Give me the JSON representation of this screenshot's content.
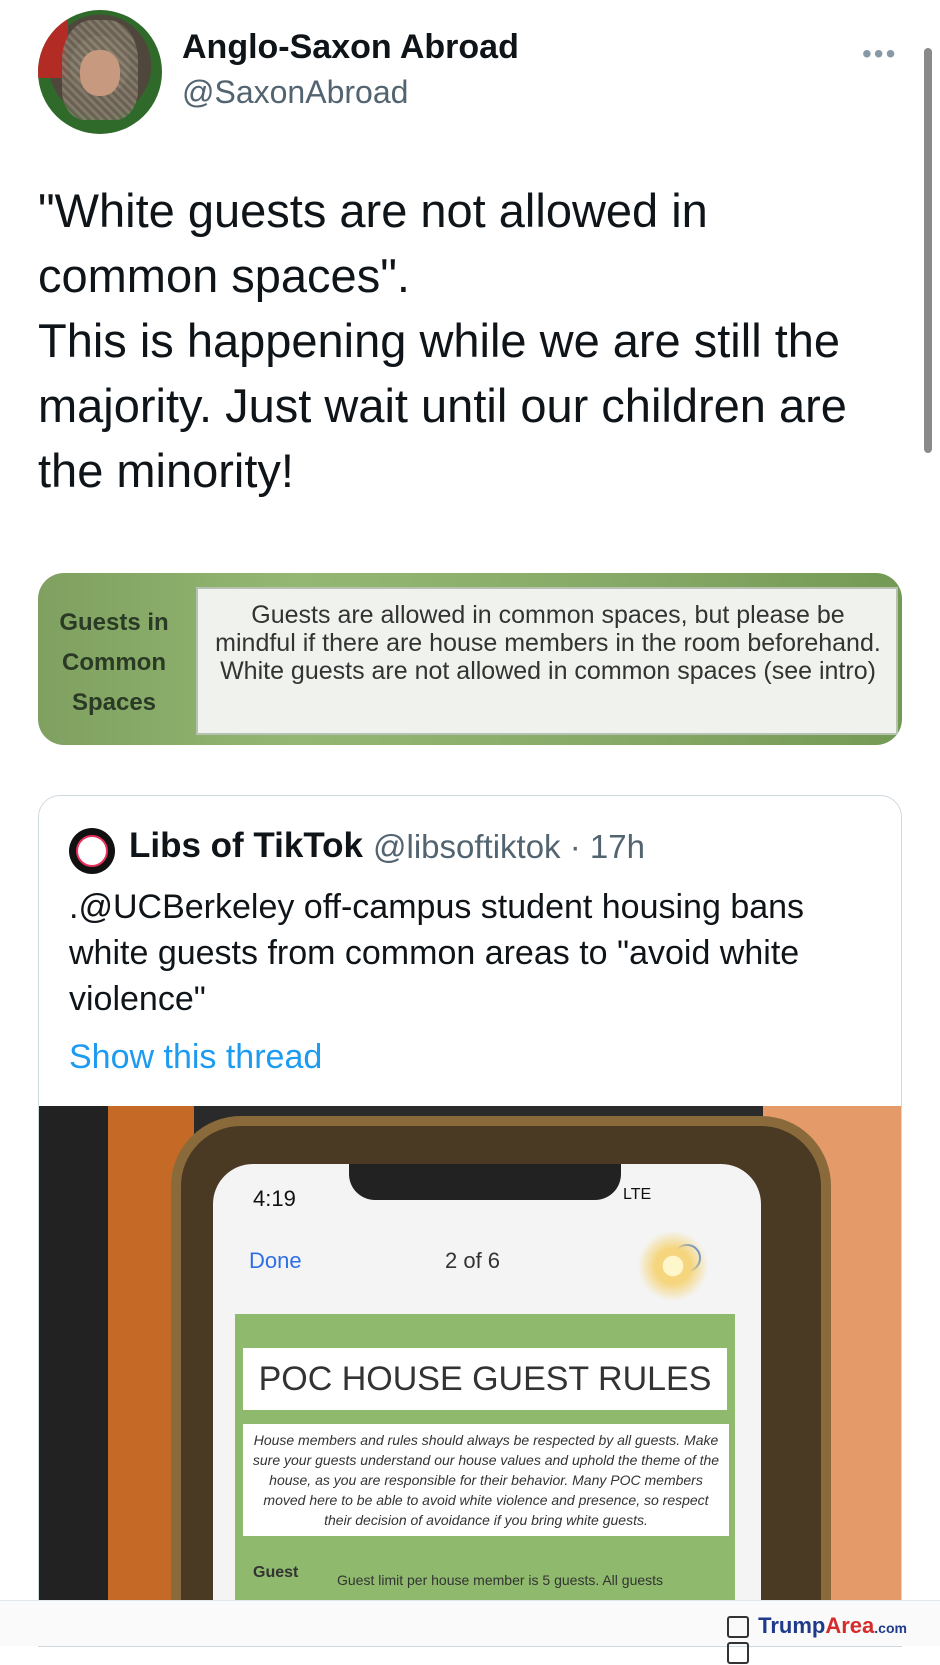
{
  "tweet": {
    "display_name": "Anglo-Saxon Abroad",
    "handle": "@SaxonAbroad",
    "more_icon": "more-dots-icon",
    "text": "\"White guests are not allowed in common spaces\".\nThis is happening while we are still the majority. Just wait until our children are the minority!"
  },
  "image1": {
    "label": "Guests in\nCommon\nSpaces",
    "rule_text": "Guests are allowed in common spaces, but please be mindful if there are house members in the room beforehand. White guests are not allowed in common spaces (see intro)"
  },
  "quoted": {
    "display_name": "Libs of TikTok",
    "handle_time": "@libsoftiktok · 17h",
    "avatar_label": "Libs of TikTok",
    "text": ".@UCBerkeley off-campus student housing bans white guests from common areas to \"avoid white violence\"",
    "show_thread": "Show this thread",
    "photo": {
      "time": "4:19",
      "status": "LTE",
      "done": "Done",
      "page": "2 of 6",
      "doc_title": "POC HOUSE GUEST RULES",
      "doc_intro": "House members and rules should always be respected by all guests. Make sure your guests understand our house values and uphold the theme of the house, as you are responsible for their behavior. Many POC members moved here to be able to avoid white violence and presence, so respect their decision of avoidance if you bring white guests.",
      "guest_label": "Guest",
      "guest_text": "Guest limit per house member is 5 guests. All guests"
    }
  },
  "watermark": {
    "prefix": "Trump",
    "accent": "Area",
    "suffix": ".com"
  }
}
